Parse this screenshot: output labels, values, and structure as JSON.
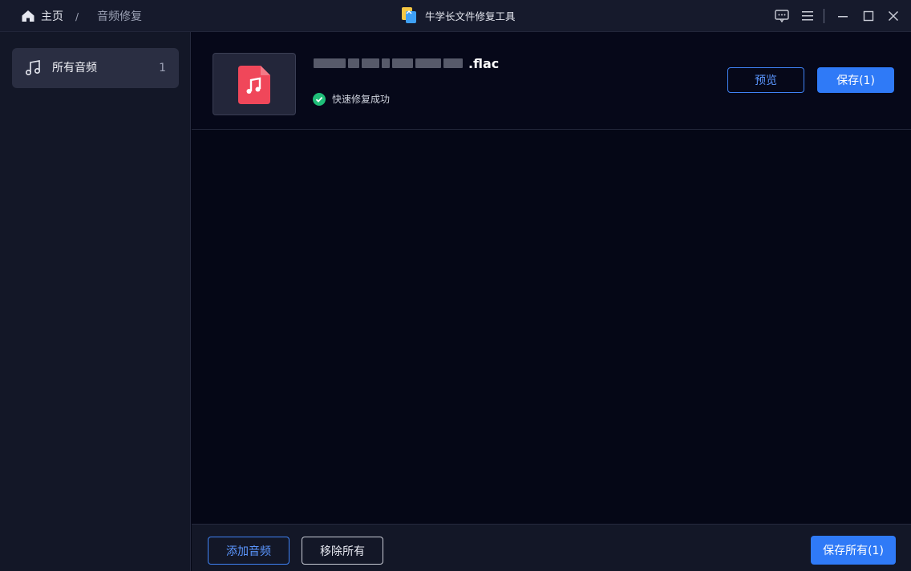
{
  "titlebar": {
    "home_label": "主页",
    "separator": "/",
    "current": "音频修复",
    "app_title": "牛学长文件修复工具",
    "icons": [
      "home-icon",
      "app-logo-icon",
      "feedback-icon",
      "menu-icon",
      "minimize-icon",
      "maximize-icon",
      "close-icon"
    ]
  },
  "sidebar": {
    "items": [
      {
        "label": "所有音频",
        "count": "1",
        "icon": "music-note-icon"
      }
    ]
  },
  "file": {
    "name_suffix": ".flac",
    "status": "快速修复成功",
    "preview_label": "预览",
    "save_label": "保存(1)"
  },
  "footer": {
    "add_label": "添加音频",
    "remove_label": "移除所有",
    "save_all_label": "保存所有(1)"
  },
  "colors": {
    "accent": "#2f7af7",
    "success": "#1fbe78",
    "audio_icon": "#f0475a"
  }
}
